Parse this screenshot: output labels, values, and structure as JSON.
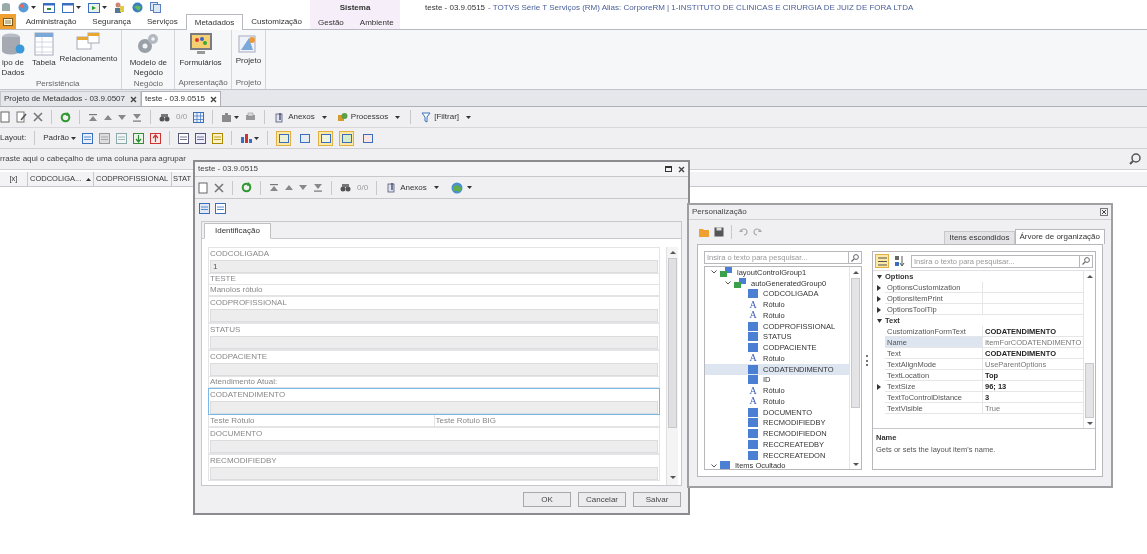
{
  "title_bar": {
    "title": "teste - 03.9.0515",
    "subtitle": "- TOTVS Série T Serviços (RM) Alias: CorporeRM | 1-INSTITUTO DE CLINICAS E CIRURGIA DE JUIZ DE FORA LTDA"
  },
  "ribbon": {
    "tabs": [
      {
        "label": "Administração",
        "selected": false
      },
      {
        "label": "Segurança",
        "selected": false
      },
      {
        "label": "Serviços",
        "selected": false
      },
      {
        "label": "Metadados",
        "selected": true
      },
      {
        "label": "Customização",
        "selected": false
      }
    ],
    "contextual_group": {
      "label": "Sistema",
      "tabs": [
        {
          "label": "Gestão",
          "selected": false
        },
        {
          "label": "Ambiente",
          "selected": false
        }
      ]
    },
    "groups": [
      {
        "label": "Persistência",
        "buttons": [
          "ipo de Dados",
          "Tabela",
          "Relacionamento"
        ]
      },
      {
        "label": "Negócio",
        "buttons": [
          "Modelo de Negócio"
        ]
      },
      {
        "label": "Apresentação",
        "buttons": [
          "Formulários"
        ]
      },
      {
        "label": "Projeto",
        "buttons": [
          "Projeto"
        ]
      }
    ]
  },
  "document_tabs": [
    {
      "label": "Projeto de Metadados - 03.9.0507",
      "selected": false
    },
    {
      "label": "teste - 03.9.0515",
      "selected": true
    }
  ],
  "main_toolbar": {
    "record_counter": "0/0",
    "buttons": [
      "Anexos",
      "Processos",
      "[Filtrar]"
    ]
  },
  "layout_toolbar": {
    "label": "Layout:",
    "preset": "Padrão",
    "toggles": [
      {
        "on": true
      },
      {
        "on": false
      },
      {
        "on": true
      },
      {
        "on": true
      },
      {
        "on": false
      }
    ]
  },
  "group_panel": {
    "hint": "rraste aqui o cabeçalho de uma coluna para agrupar"
  },
  "grid": {
    "columns": [
      {
        "label": "[x]",
        "sorted": false
      },
      {
        "label": "CODCOLIGA...",
        "sorted": true
      },
      {
        "label": "CODPROFISSIONAL",
        "sorted": false
      },
      {
        "label": "STAT",
        "sorted": false
      }
    ]
  },
  "form_window": {
    "title": "teste - 03.9.0515",
    "record_counter": "0/0",
    "attachments": "Anexos",
    "tabs": [
      {
        "label": "Identificação",
        "selected": true
      }
    ],
    "items": [
      {
        "kind": "field",
        "label": "CODCOLIGADA",
        "value": "1",
        "focused": false
      },
      {
        "kind": "label",
        "text": "TESTE"
      },
      {
        "kind": "label",
        "text": "Manolos rótulo"
      },
      {
        "kind": "field",
        "label": "CODPROFISSIONAL",
        "focused": false
      },
      {
        "kind": "field",
        "label": "STATUS",
        "focused": false
      },
      {
        "kind": "field",
        "label": "CODPACIENTE",
        "focused": false
      },
      {
        "kind": "label",
        "text": "Atendimento Atual:"
      },
      {
        "kind": "field",
        "label": "CODATENDIMENTO",
        "focused": true
      },
      {
        "kind": "pair",
        "texts": [
          "Teste Rótulo",
          "Teste Rotulo BIG"
        ]
      },
      {
        "kind": "field",
        "label": "DOCUMENTO",
        "focused": false
      },
      {
        "kind": "field",
        "label": "RECMODIFIEDBY",
        "focused": false
      }
    ],
    "buttons": [
      "OK",
      "Cancelar",
      "Salvar"
    ]
  },
  "customization_window": {
    "title": "Personalização",
    "tabs": [
      {
        "label": "Itens escondidos",
        "selected": false
      },
      {
        "label": "Árvore de organização",
        "selected": true
      }
    ],
    "tree": {
      "placeholder": "Insira o texto para pesquisar...",
      "items": [
        {
          "kind": "group",
          "label": "layoutControlGroup1",
          "expanded": true,
          "selected": false,
          "children": [
            {
              "kind": "group",
              "label": "autoGeneratedGroup0",
              "expanded": true,
              "selected": false,
              "children": [
                {
                  "kind": "item",
                  "label": "CODCOLIGADA",
                  "selected": false
                },
                {
                  "kind": "label",
                  "glyph": "A",
                  "label": "Rótulo",
                  "selected": false
                },
                {
                  "kind": "label",
                  "glyph": "A",
                  "label": "Rótulo",
                  "selected": false
                },
                {
                  "kind": "item",
                  "label": "CODPROFISSIONAL",
                  "selected": false
                },
                {
                  "kind": "item",
                  "label": "STATUS",
                  "selected": false
                },
                {
                  "kind": "item",
                  "label": "CODPACIENTE",
                  "selected": false
                },
                {
                  "kind": "label",
                  "glyph": "A",
                  "label": "Rótulo",
                  "selected": false
                },
                {
                  "kind": "item",
                  "label": "CODATENDIMENTO",
                  "selected": true
                },
                {
                  "kind": "item",
                  "label": "ID",
                  "selected": false
                },
                {
                  "kind": "label",
                  "glyph": "A",
                  "label": "Rótulo",
                  "selected": false
                },
                {
                  "kind": "label",
                  "glyph": "A",
                  "label": "Rótulo",
                  "selected": false
                },
                {
                  "kind": "item",
                  "label": "DOCUMENTO",
                  "selected": false
                },
                {
                  "kind": "item",
                  "label": "RECMODIFIEDBY",
                  "selected": false
                },
                {
                  "kind": "item",
                  "label": "RECMODIFIEDON",
                  "selected": false
                },
                {
                  "kind": "item",
                  "label": "RECCREATEDBY",
                  "selected": false
                },
                {
                  "kind": "item",
                  "label": "RECCREATEDON",
                  "selected": false
                }
              ]
            }
          ]
        },
        {
          "kind": "item",
          "label": "Items Ocultado",
          "expanded": true,
          "selected": false
        }
      ]
    },
    "properties": {
      "placeholder": "Insira o texto para pesquisar...",
      "categorized": true,
      "categories": [
        {
          "label": "Options",
          "expanded": true,
          "rows": [
            {
              "name": "OptionsCustomization",
              "expandable": true,
              "selected": false
            },
            {
              "name": "OptionsItemPrint",
              "expandable": true,
              "selected": false
            },
            {
              "name": "OptionsToolTip",
              "expandable": true,
              "selected": false
            }
          ]
        },
        {
          "label": "Text",
          "expanded": true,
          "rows": [
            {
              "name": "CustomizationFormText",
              "value": "CODATENDIMENTO",
              "expandable": false,
              "modified": true,
              "selected": false
            },
            {
              "name": "Name",
              "value": "ItemForCODATENDIMENTO",
              "expandable": false,
              "modified": false,
              "selected": true
            },
            {
              "name": "Text",
              "value": "CODATENDIMENTO",
              "expandable": false,
              "modified": true,
              "selected": false
            },
            {
              "name": "TextAlignMode",
              "value": "UseParentOptions",
              "expandable": false,
              "modified": false,
              "selected": false
            },
            {
              "name": "TextLocation",
              "value": "Top",
              "expandable": false,
              "modified": true,
              "selected": false
            },
            {
              "name": "TextSize",
              "value": "96; 13",
              "expandable": true,
              "modified": true,
              "selected": false
            },
            {
              "name": "TextToControlDistance",
              "value": "3",
              "expandable": false,
              "modified": true,
              "selected": false
            },
            {
              "name": "TextVisible",
              "value": "True",
              "expandable": false,
              "modified": false,
              "selected": false
            }
          ]
        }
      ],
      "description": {
        "title": "Name",
        "text": "Gets or sets the layout item's name."
      }
    }
  }
}
